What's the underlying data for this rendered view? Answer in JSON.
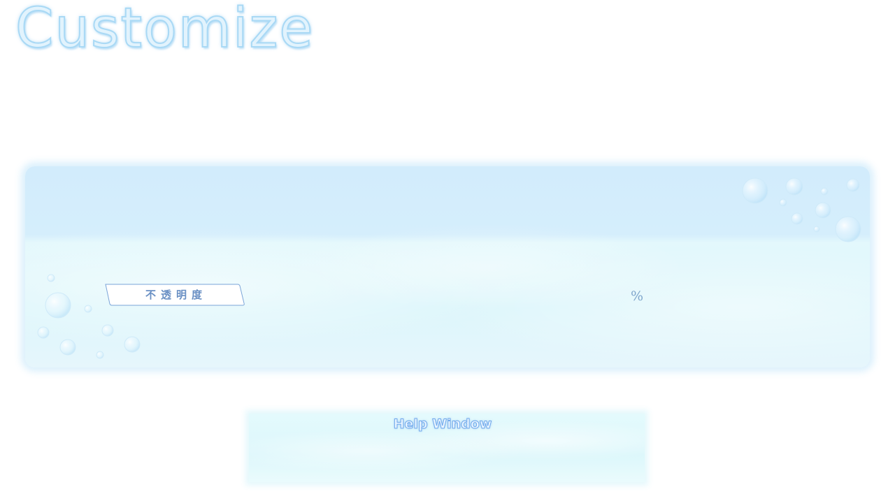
{
  "screen": {
    "title": "Customize"
  },
  "settings_panel": {
    "opacity": {
      "label": "不透明度",
      "unit": "%"
    }
  },
  "help_window": {
    "title": "Help Window"
  },
  "colors": {
    "title_fill": "#e2f3fd",
    "title_outline": "#a9d9f5",
    "label_border": "#7aa4d8",
    "label_text": "#6a90c4",
    "help_title_outline": "#6fa8ec"
  }
}
